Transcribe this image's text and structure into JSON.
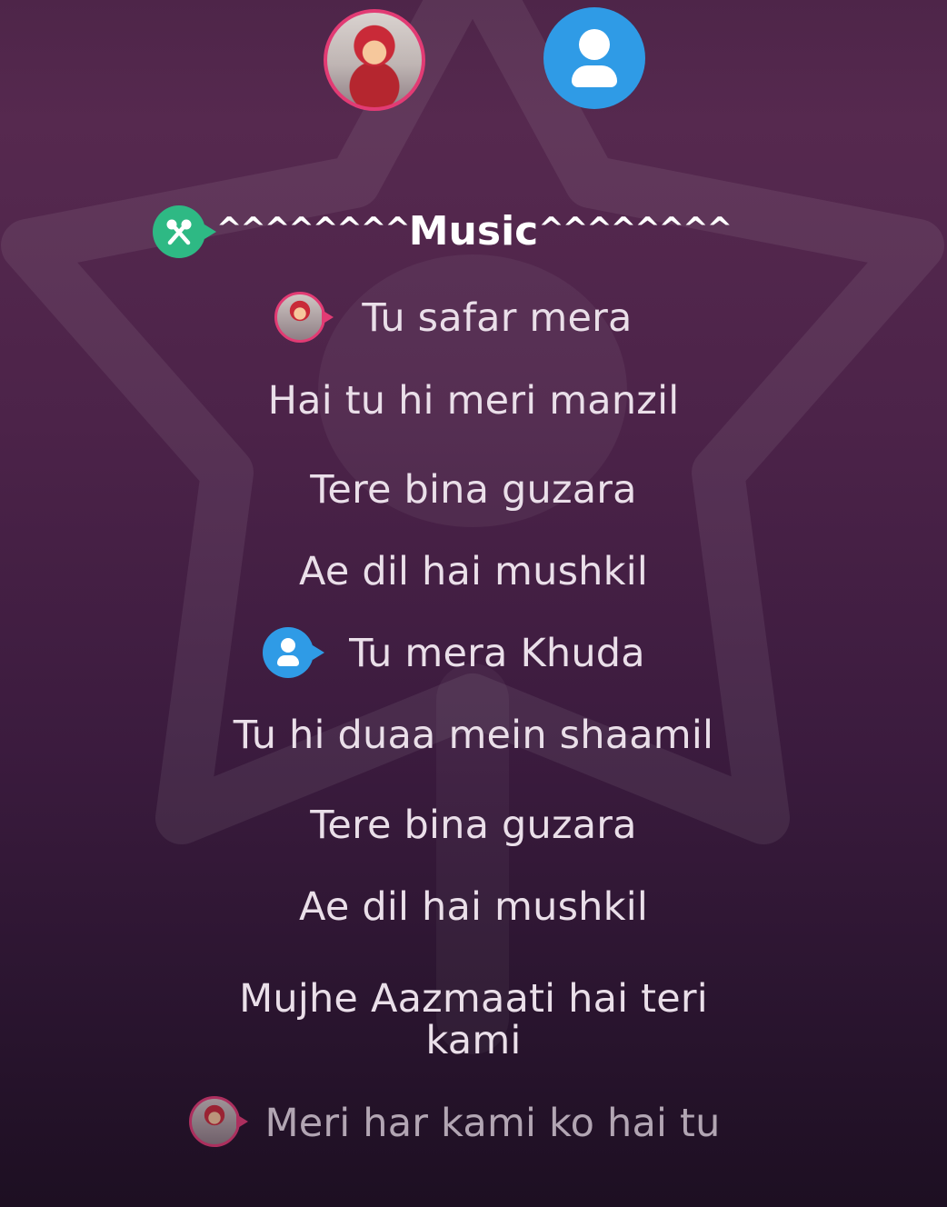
{
  "title": {
    "carets_left": "^^^^^^^^",
    "text": "Music",
    "carets_right": "^^^^^^^^"
  },
  "lyrics": [
    "Tu safar mera",
    "Hai tu hi meri manzil",
    "Tere bina guzara",
    "Ae dil hai mushkil",
    "Tu mera Khuda",
    "Tu hi duaa mein shaamil",
    "Tere bina guzara",
    "Ae dil hai mushkil",
    "Mujhe Aazmaati hai teri",
    "kami",
    "Meri har kami ko hai tu"
  ],
  "colors": {
    "accent_pink": "#e23b74",
    "accent_blue": "#2f9be6",
    "accent_green": "#2eb984",
    "lyric_text": "#eadfe9"
  },
  "icons": {
    "singer_one": "cartoon-avatar",
    "singer_two": "user-avatar",
    "music_badge": "microphones-icon"
  }
}
